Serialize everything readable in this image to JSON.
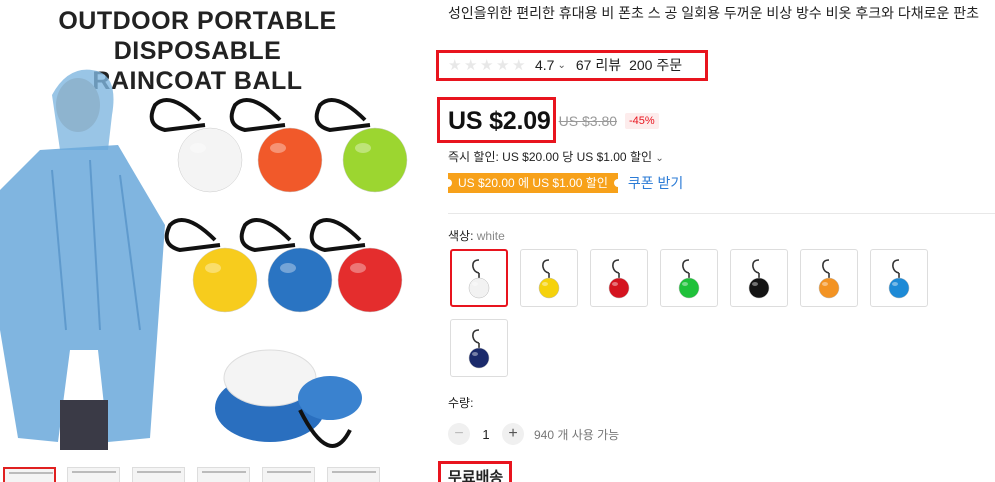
{
  "gallery": {
    "image_title_line1": "OUTDOOR PORTABLE DISPOSABLE",
    "image_title_line2": "RAINCOAT BALL",
    "ball_colors": [
      "#f4f4f4",
      "#f1592a",
      "#9cd630",
      "#f7cc1d",
      "#2a74c2",
      "#e42d2d"
    ],
    "thumb_count": 6
  },
  "product": {
    "title": "성인을위한 편리한 휴대용 비 폰초 스 공 일회용 두꺼운 비상 방수 비옷 후크와 다채로운 판초",
    "rating": "4.7",
    "reviews": "67 리뷰",
    "orders": "200 주문",
    "price": "US $2.09",
    "old_price": "US $3.80",
    "discount": "-45%",
    "instant_discount": "즉시 할인: US $20.00 당 US $1.00 할인",
    "coupon_tag": "US $20.00 에 US $1.00 할인",
    "coupon_link": "쿠폰 받기",
    "color_label": "색상:",
    "color_value": "white",
    "colors": [
      {
        "name": "white",
        "hex": "#f2f2f2"
      },
      {
        "name": "yellow",
        "hex": "#f5d20c"
      },
      {
        "name": "red",
        "hex": "#d4141f"
      },
      {
        "name": "green",
        "hex": "#1fc13a"
      },
      {
        "name": "black",
        "hex": "#141414"
      },
      {
        "name": "orange",
        "hex": "#f39323"
      },
      {
        "name": "blue",
        "hex": "#1d8ad6"
      },
      {
        "name": "navy",
        "hex": "#1b2a6b"
      }
    ],
    "qty_label": "수량:",
    "qty_minus": "−",
    "qty_value": "1",
    "qty_plus": "+",
    "qty_available": "940 개 사용 가능",
    "shipping": "무료배송"
  }
}
